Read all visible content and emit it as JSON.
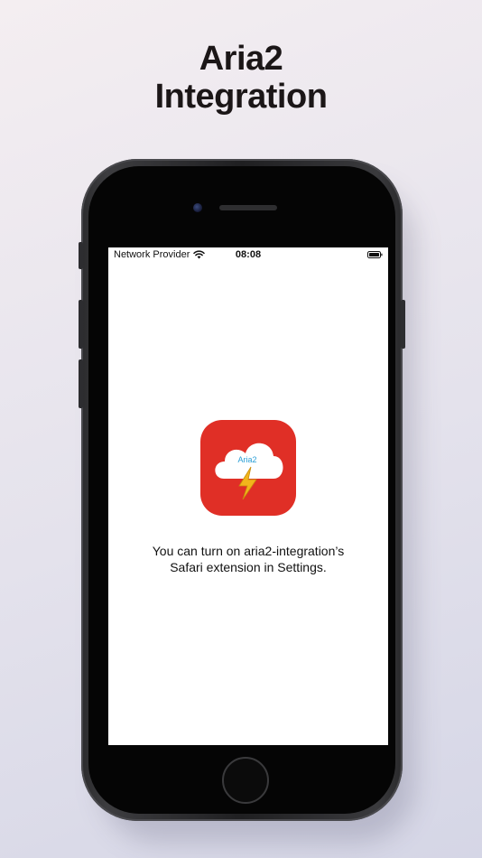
{
  "headline": {
    "line1": "Aria2",
    "line2": "Integration"
  },
  "status_bar": {
    "carrier": "Network Provider",
    "time": "08:08",
    "wifi_icon": "wifi-icon",
    "battery_icon": "battery-icon"
  },
  "app_icon": {
    "label": "Aria2",
    "icon": "cloud-lightning-icon",
    "background_color": "#e02f26",
    "bolt_color": "#f2b51b",
    "label_color": "#2a9fd6"
  },
  "message": {
    "line1": "You can turn on aria2-integration’s",
    "line2": "Safari extension in Settings."
  }
}
